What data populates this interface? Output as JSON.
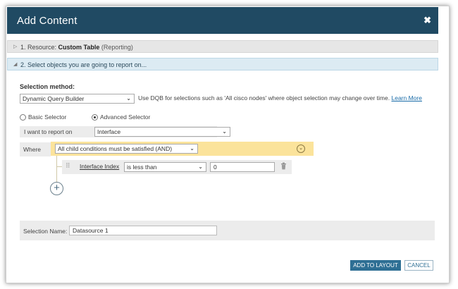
{
  "dialog": {
    "title": "Add Content",
    "close_icon": "close-icon"
  },
  "sections": {
    "resource": {
      "prefix": "1. Resource:",
      "name": "Custom Table",
      "sub": "(Reporting)"
    },
    "select": {
      "text": "2. Select objects you are going to report on..."
    }
  },
  "selection_method": {
    "label": "Selection method:",
    "value": "Dynamic Query Builder",
    "help": "Use DQB for selections such as 'All cisco nodes' where object selection may change over time.",
    "learn_more": "Learn More"
  },
  "selector_mode": {
    "basic": "Basic Selector",
    "advanced": "Advanced Selector",
    "selected": "advanced"
  },
  "report_on": {
    "label": "I want to report on",
    "value": "Interface"
  },
  "where": {
    "label": "Where",
    "condition": "All child conditions must be satisfied (AND)",
    "toggle_icon": "chevron-down-icon"
  },
  "rule": {
    "field": "Interface Index",
    "operator": "is less than",
    "value": "0",
    "drag_icon": "drag-handle-icon",
    "delete_icon": "trash-icon"
  },
  "add_condition": {
    "symbol": "+",
    "icon": "plus-icon"
  },
  "selection_name": {
    "label": "Selection Name:",
    "value": "Datasource 1"
  },
  "footer": {
    "add_label": "ADD TO LAYOUT",
    "cancel_label": "CANCEL"
  },
  "colors": {
    "titlebar": "#204a63",
    "condition_bar": "#fbe39b",
    "primary_button": "#2e6f94",
    "link": "#1a6ca8"
  }
}
